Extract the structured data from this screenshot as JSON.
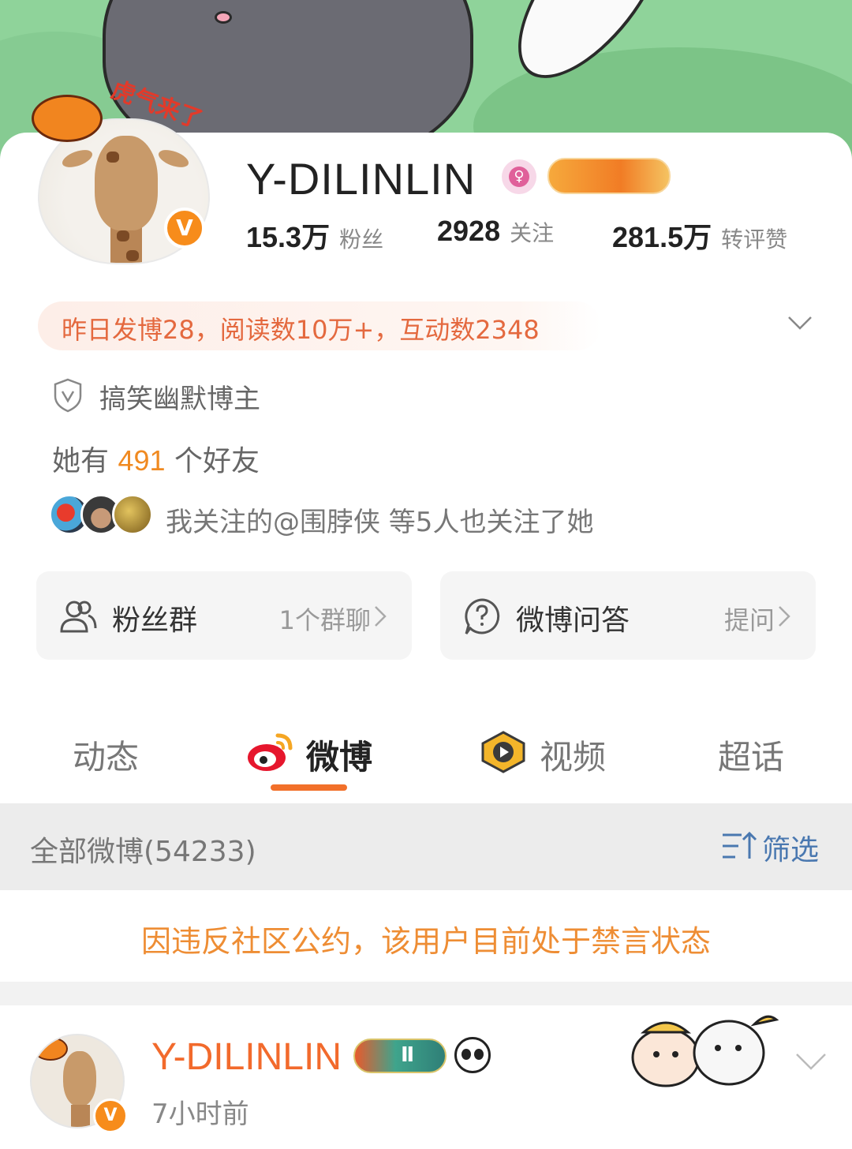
{
  "profile": {
    "username": "Y-DILINLIN",
    "gender_symbol": "♀",
    "verified_badge": "V",
    "avatar_sticker_text": "虎气来了",
    "stats": {
      "followers_value": "15.3万",
      "followers_label": "粉丝",
      "following_value": "2928",
      "following_label": "关注",
      "interactions_value": "281.5万",
      "interactions_label": "转评赞"
    },
    "yesterday_summary": "昨日发博28，阅读数10万+，互动数2348",
    "certification": "搞笑幽默博主",
    "friends": {
      "prefix": "她有",
      "count": "491",
      "suffix": "个好友"
    },
    "mutual_follow_text": "我关注的@围脖侠 等5人也关注了她"
  },
  "actions": {
    "fan_group": {
      "label": "粉丝群",
      "detail": "1个群聊"
    },
    "qa": {
      "label": "微博问答",
      "detail": "提问"
    }
  },
  "tabs": [
    {
      "label": "动态",
      "active": false
    },
    {
      "label": "微博",
      "active": true
    },
    {
      "label": "视频",
      "active": false
    },
    {
      "label": "超话",
      "active": false
    }
  ],
  "feed": {
    "all_posts_label": "全部微博(54233)",
    "filter_label": "筛选",
    "notice": "因违反社区公约，该用户目前处于禁言状态"
  },
  "post": {
    "author": "Y-DILINLIN",
    "level_badge": "Ⅱ",
    "time": "7小时前"
  },
  "colors": {
    "accent_orange": "#f2702a",
    "username_orange": "#f26a2c",
    "notice_orange": "#ee8d34",
    "filter_blue": "#4a78b0",
    "verified_orange": "#f78c1b"
  },
  "icons": {
    "gender": "female-icon",
    "certification": "shield-icon",
    "fan_group": "people-icon",
    "qa": "question-icon",
    "tab_weibo": "weibo-logo-icon",
    "tab_video": "video-play-icon",
    "filter": "sort-filter-icon",
    "expand": "chevron-down-icon"
  }
}
